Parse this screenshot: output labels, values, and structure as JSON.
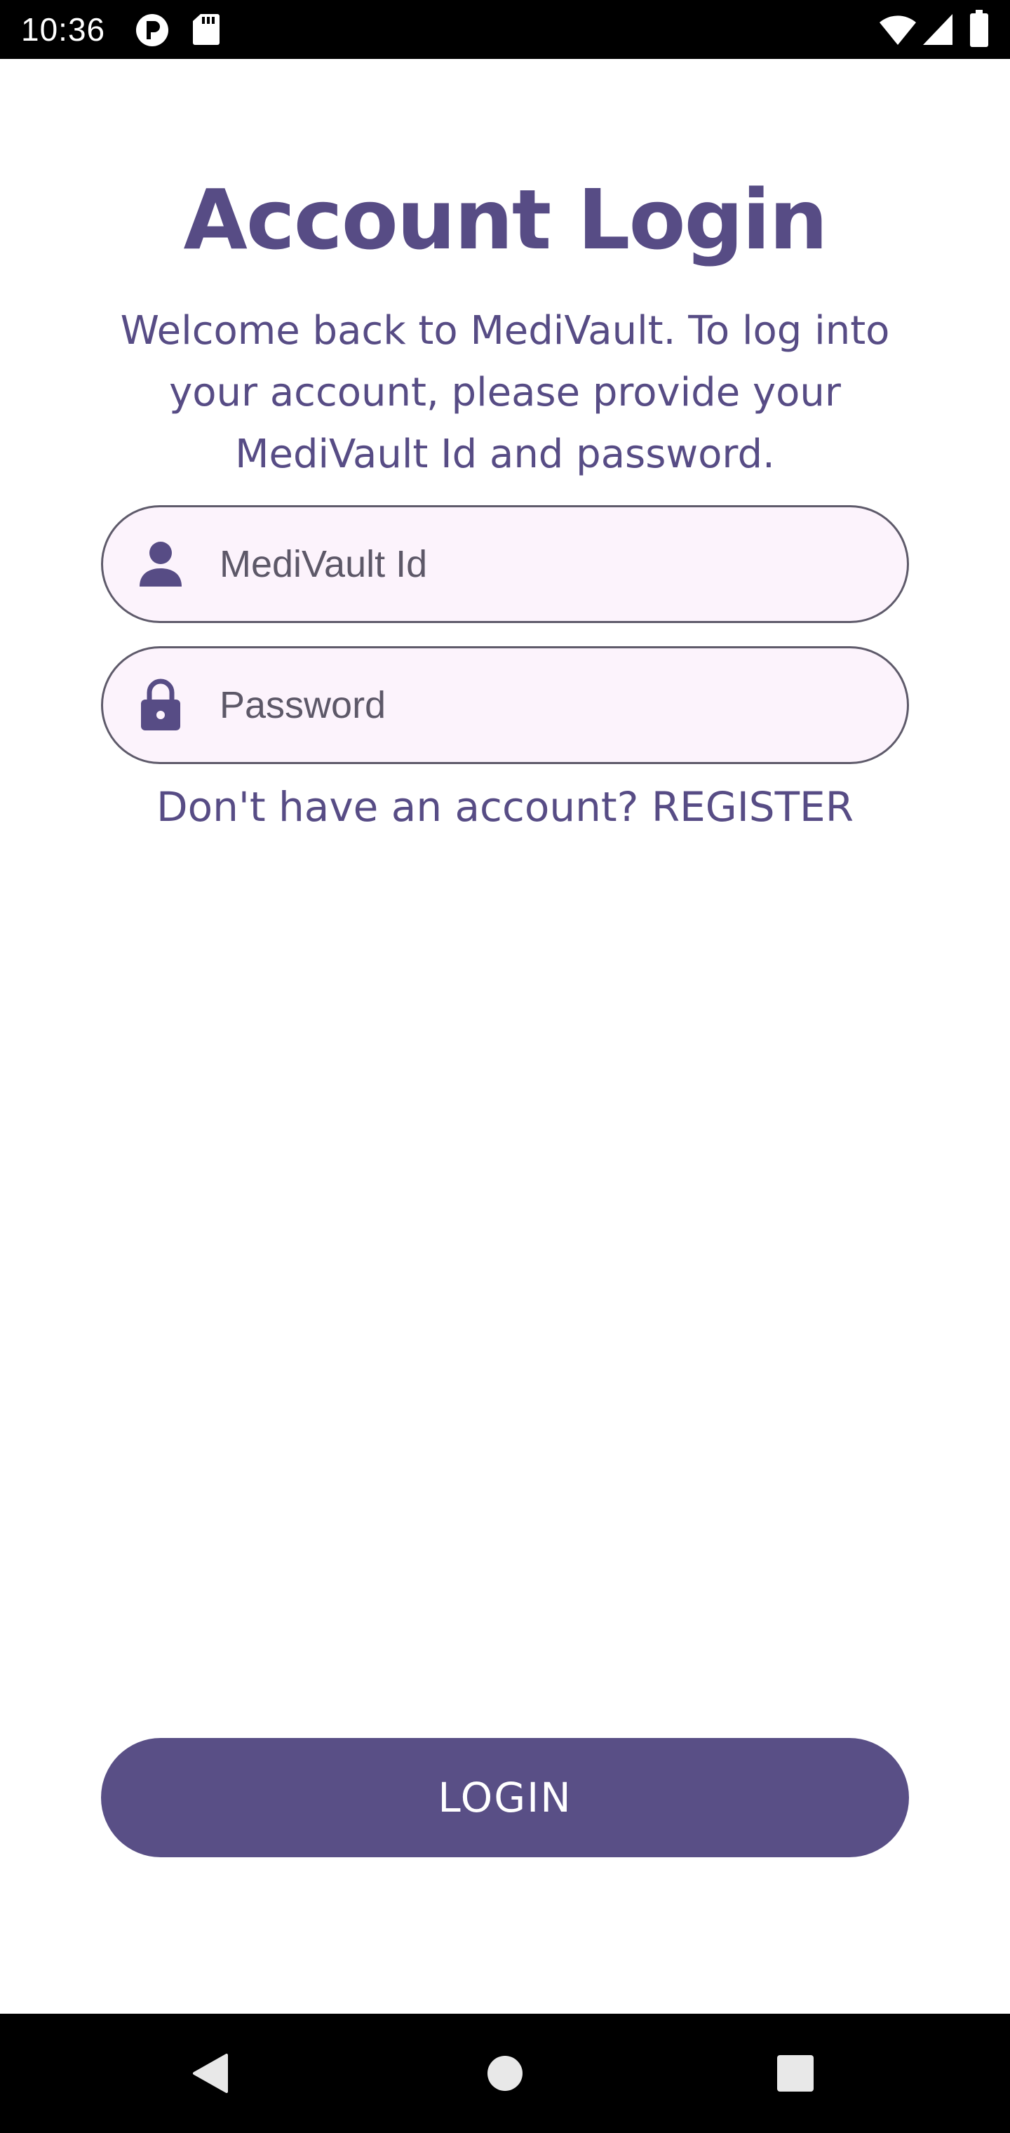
{
  "status_bar": {
    "time": "10:36",
    "icons": [
      "app-notification-icon",
      "sd-card-icon",
      "wifi-icon",
      "signal-icon",
      "battery-icon"
    ]
  },
  "login": {
    "title": "Account Login",
    "subtitle": "Welcome back to MediVault. To log into your account, please provide your MediVault Id and password.",
    "id_field": {
      "placeholder": "MediVault Id",
      "value": "",
      "icon": "person-icon"
    },
    "password_field": {
      "placeholder": "Password",
      "value": "",
      "icon": "lock-icon"
    },
    "register_prompt": "Don't have an account?",
    "register_link": "REGISTER",
    "login_button": "LOGIN"
  },
  "nav_bar": {
    "buttons": [
      "back-icon",
      "home-icon",
      "recents-icon"
    ]
  },
  "colors": {
    "accent": "#574c85",
    "field_background": "#fcf3fc",
    "field_border": "#5e5a6a",
    "button_background": "#594f86"
  }
}
